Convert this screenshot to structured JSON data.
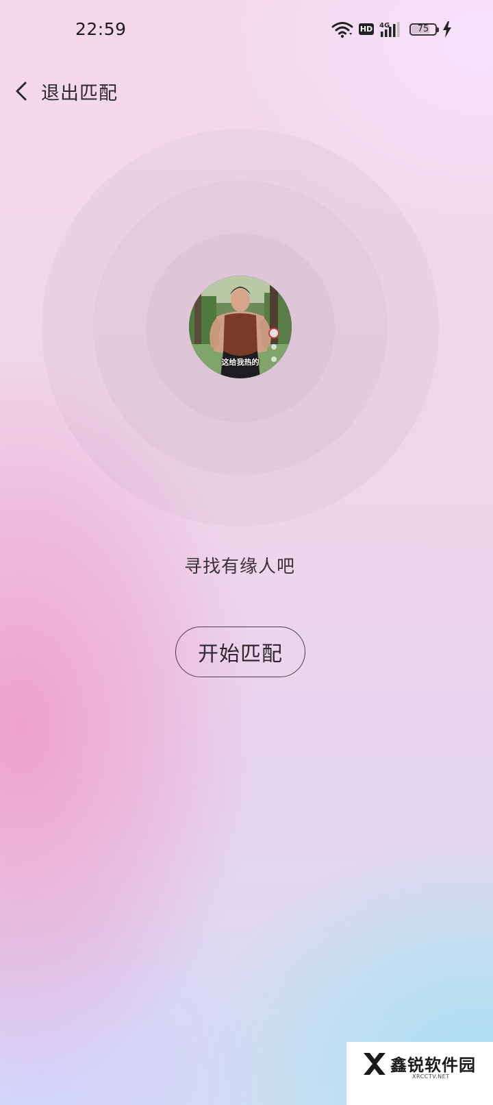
{
  "status_bar": {
    "time": "22:59",
    "network": "4G",
    "hd_label": "HD",
    "battery_level": "75",
    "battery_fraction": 0.75,
    "icons": [
      "wifi-icon",
      "hd-icon",
      "signal-4g-icon",
      "battery-icon",
      "charging-bolt-icon"
    ]
  },
  "header": {
    "back_icon": "chevron-left-icon",
    "title": "退出匹配"
  },
  "match": {
    "avatar_caption": "这给我热的",
    "hint": "寻找有缘人吧",
    "start_button_label": "开始匹配"
  },
  "watermark": {
    "title": "鑫锐软件园",
    "subtitle": "XRCCTV.NET"
  },
  "colors": {
    "text_primary": "#2a2a2c",
    "button_border": "#4a3e48",
    "bg_pink": "#efa0c8",
    "bg_blue": "#aadef2",
    "bg_lavender": "#d4d4fc"
  }
}
